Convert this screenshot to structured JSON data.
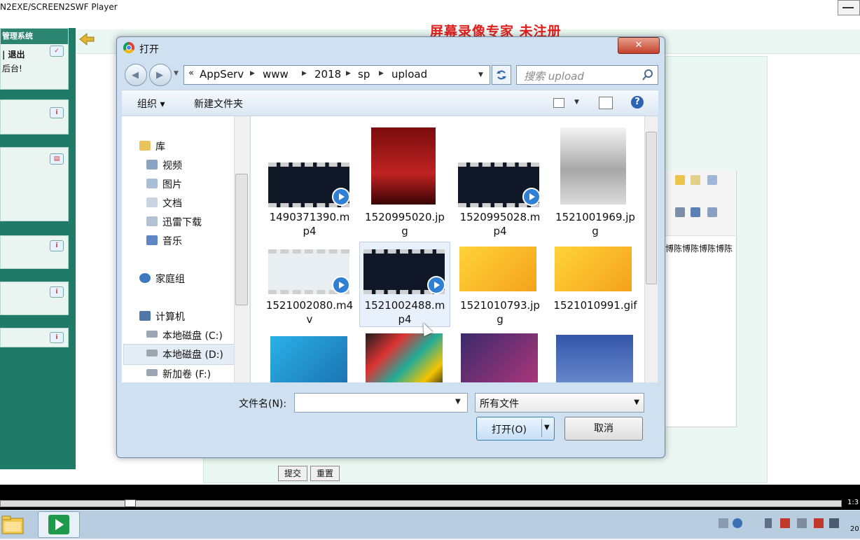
{
  "player": {
    "title": "N2EXE/SCREEN2SWF Player",
    "time": "1:3"
  },
  "watermark": "屏幕录像专家  未注册",
  "background_page": {
    "nav_header": "管理系统",
    "nav_line1": "| 退出",
    "nav_line2": "后台!",
    "editor_text": "博陈博陈博陈博陈",
    "buttons": {
      "submit": "提交",
      "reset": "重置"
    }
  },
  "dialog": {
    "title": "打开",
    "address": [
      "AppServ",
      "www",
      "2018",
      "sp",
      "upload"
    ],
    "address_prefix": "«",
    "search_placeholder": "搜索 upload",
    "toolbar": {
      "organize": "组织 ▾",
      "new_folder": "新建文件夹",
      "help": "?"
    },
    "nav_tree": [
      {
        "label": "库",
        "icon": "library-icon"
      },
      {
        "label": "视频",
        "icon": "video-library-icon"
      },
      {
        "label": "图片",
        "icon": "pictures-library-icon"
      },
      {
        "label": "文档",
        "icon": "documents-library-icon"
      },
      {
        "label": "迅雷下载",
        "icon": "downloads-library-icon"
      },
      {
        "label": "音乐",
        "icon": "music-library-icon"
      },
      {
        "label": "家庭组",
        "icon": "homegroup-icon"
      },
      {
        "label": "计算机",
        "icon": "computer-icon"
      },
      {
        "label": "本地磁盘 (C:)",
        "icon": "drive-icon"
      },
      {
        "label": "本地磁盘 (D:)",
        "icon": "drive-icon"
      },
      {
        "label": "新加卷 (F:)",
        "icon": "drive-icon"
      }
    ],
    "files": [
      {
        "name_line1": "1490371390.m",
        "name_line2": "p4",
        "kind": "video"
      },
      {
        "name_line1": "1520995020.jp",
        "name_line2": "g",
        "kind": "image-poster-red"
      },
      {
        "name_line1": "1520995028.m",
        "name_line2": "p4",
        "kind": "video"
      },
      {
        "name_line1": "1521001969.jp",
        "name_line2": "g",
        "kind": "image-poster-lucy"
      },
      {
        "name_line1": "1521002080.m4",
        "name_line2": "v",
        "kind": "video-light"
      },
      {
        "name_line1": "1521002488.m",
        "name_line2": "p4",
        "kind": "video",
        "selected": true
      },
      {
        "name_line1": "1521010793.jp",
        "name_line2": "g",
        "kind": "image-yellow"
      },
      {
        "name_line1": "1521010991.gif",
        "name_line2": "",
        "kind": "image-yellow"
      },
      {
        "name_line1": "",
        "name_line2": "",
        "kind": "image-blue"
      },
      {
        "name_line1": "",
        "name_line2": "",
        "kind": "image-colorful"
      },
      {
        "name_line1": "",
        "name_line2": "",
        "kind": "image-purple"
      },
      {
        "name_line1": "",
        "name_line2": "",
        "kind": "image-browser"
      }
    ],
    "filename_label": "文件名(N):",
    "filename_value": "",
    "filetype": "所有文件",
    "open_button": "打开(O)",
    "cancel_button": "取消"
  }
}
